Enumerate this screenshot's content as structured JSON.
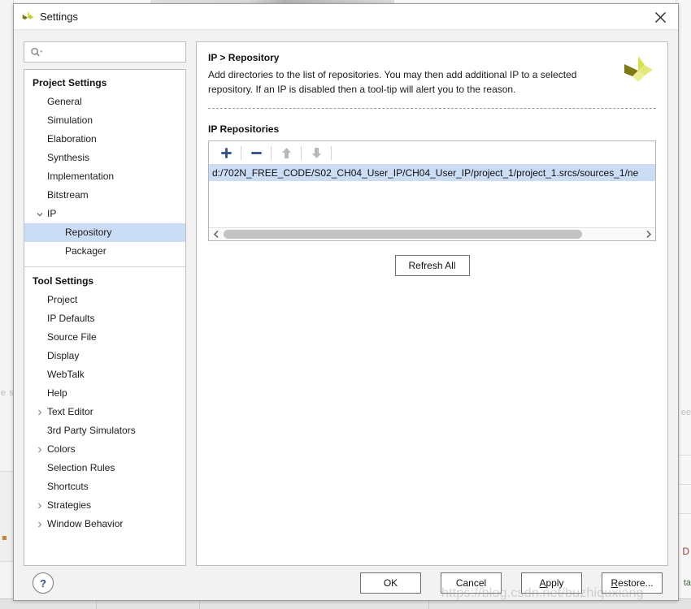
{
  "window": {
    "title": "Settings",
    "app_logo_icon": "vivado-logo-icon",
    "close_icon": "close-icon"
  },
  "search": {
    "placeholder": "",
    "value": "",
    "icon": "search-icon",
    "dropdown_icon": "chevron-down-icon"
  },
  "sidebar": {
    "groups": [
      {
        "title": "Project Settings",
        "items": [
          {
            "label": "General",
            "depth": 1,
            "twisty": "none",
            "selected": false
          },
          {
            "label": "Simulation",
            "depth": 1,
            "twisty": "none",
            "selected": false
          },
          {
            "label": "Elaboration",
            "depth": 1,
            "twisty": "none",
            "selected": false
          },
          {
            "label": "Synthesis",
            "depth": 1,
            "twisty": "none",
            "selected": false
          },
          {
            "label": "Implementation",
            "depth": 1,
            "twisty": "none",
            "selected": false
          },
          {
            "label": "Bitstream",
            "depth": 1,
            "twisty": "none",
            "selected": false
          },
          {
            "label": "IP",
            "depth": 1,
            "twisty": "expanded",
            "selected": false
          },
          {
            "label": "Repository",
            "depth": 2,
            "twisty": "none",
            "selected": true
          },
          {
            "label": "Packager",
            "depth": 2,
            "twisty": "none",
            "selected": false
          }
        ]
      },
      {
        "title": "Tool Settings",
        "items": [
          {
            "label": "Project",
            "depth": 1,
            "twisty": "none",
            "selected": false
          },
          {
            "label": "IP Defaults",
            "depth": 1,
            "twisty": "none",
            "selected": false
          },
          {
            "label": "Source File",
            "depth": 1,
            "twisty": "none",
            "selected": false
          },
          {
            "label": "Display",
            "depth": 1,
            "twisty": "none",
            "selected": false
          },
          {
            "label": "WebTalk",
            "depth": 1,
            "twisty": "none",
            "selected": false
          },
          {
            "label": "Help",
            "depth": 1,
            "twisty": "none",
            "selected": false
          },
          {
            "label": "Text Editor",
            "depth": 1,
            "twisty": "collapsed",
            "selected": false
          },
          {
            "label": "3rd Party Simulators",
            "depth": 1,
            "twisty": "none",
            "selected": false
          },
          {
            "label": "Colors",
            "depth": 1,
            "twisty": "collapsed",
            "selected": false
          },
          {
            "label": "Selection Rules",
            "depth": 1,
            "twisty": "none",
            "selected": false
          },
          {
            "label": "Shortcuts",
            "depth": 1,
            "twisty": "none",
            "selected": false
          },
          {
            "label": "Strategies",
            "depth": 1,
            "twisty": "collapsed",
            "selected": false
          },
          {
            "label": "Window Behavior",
            "depth": 1,
            "twisty": "collapsed",
            "selected": false
          }
        ]
      }
    ]
  },
  "pane": {
    "title": "IP > Repository",
    "description": "Add directories to the list of repositories. You may then add additional IP to a selected repository. If an IP is disabled then a tool-tip will alert you to the reason.",
    "logo_icon": "vivado-logo-icon",
    "section_label": "IP Repositories",
    "toolbar": [
      {
        "name": "add-repository-button",
        "icon": "plus-icon",
        "enabled": true
      },
      {
        "name": "remove-repository-button",
        "icon": "minus-icon",
        "enabled": true
      },
      {
        "name": "move-up-button",
        "icon": "arrow-up-icon",
        "enabled": false
      },
      {
        "name": "move-down-button",
        "icon": "arrow-down-icon",
        "enabled": false
      }
    ],
    "repositories": [
      {
        "path": "d:/702N_FREE_CODE/S02_CH04_User_IP/CH04_User_IP/project_1/project_1.srcs/sources_1/ne",
        "selected": true
      }
    ],
    "refresh_label": "Refresh All",
    "scroll_left_icon": "chevron-left-icon",
    "scroll_right_icon": "chevron-right-icon"
  },
  "footer": {
    "help_label": "?",
    "buttons": [
      {
        "name": "ok-button",
        "label": "OK",
        "accel": ""
      },
      {
        "name": "cancel-button",
        "label": "Cancel",
        "accel": ""
      },
      {
        "name": "apply-button",
        "label": "Apply",
        "accel": "A"
      },
      {
        "name": "restore-button",
        "label": "Restore...",
        "accel": "R"
      }
    ]
  },
  "watermark": {
    "text": "https://blog.csdn.net/buzhiquxiang"
  },
  "backdrop": {
    "left_fragment": "e s",
    "right_fragment": "ee",
    "right_letter": "D",
    "right_tail": "ta",
    "watermark_tail": "ang"
  },
  "colors": {
    "selection": "#cbdcf5",
    "toolbar_enabled": "#2e4f86",
    "toolbar_disabled": "#b8b8b8",
    "logo_dark": "#7d7a14",
    "logo_light": "#d9e04a",
    "logo_mid": "#c3cc2e",
    "help_accent": "#2f4f86"
  }
}
